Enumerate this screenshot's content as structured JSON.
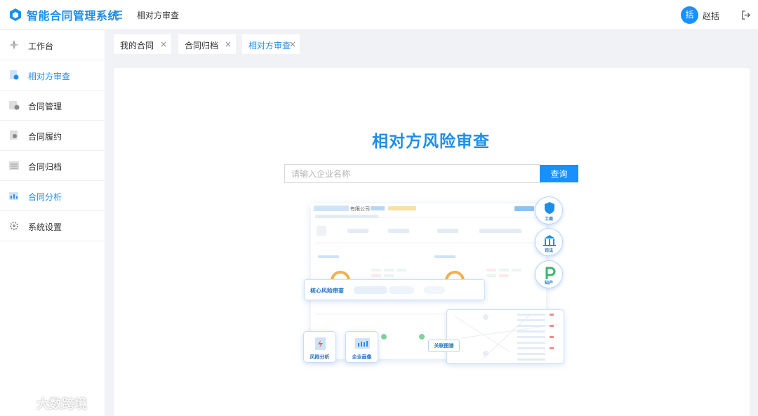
{
  "app": {
    "title": "智能合同管理系统"
  },
  "header": {
    "breadcrumb": "相对方审查",
    "user": {
      "avatar_text": "括",
      "name": "赵括"
    }
  },
  "sidebar": {
    "items": [
      {
        "label": "工作台",
        "icon": "dashboard-icon",
        "active": false
      },
      {
        "label": "相对方审查",
        "icon": "review-icon",
        "active": true
      },
      {
        "label": "合同管理",
        "icon": "contract-manage-icon",
        "active": false
      },
      {
        "label": "合同履约",
        "icon": "fulfillment-icon",
        "active": false
      },
      {
        "label": "合同归档",
        "icon": "archive-icon",
        "active": false
      },
      {
        "label": "合同分析",
        "icon": "analysis-icon",
        "active": true
      },
      {
        "label": "系统设置",
        "icon": "settings-icon",
        "active": false
      }
    ]
  },
  "tabs": [
    {
      "label": "我的合同",
      "close": "×",
      "active": false
    },
    {
      "label": "合同归档",
      "close": "×",
      "active": false
    },
    {
      "label": "相对方审查",
      "close": "×",
      "active": true
    }
  ],
  "main": {
    "title": "相对方风险审查",
    "search": {
      "placeholder": "请输入企业名称",
      "value": "",
      "button": "查询"
    },
    "illustration": {
      "company_suffix": "有限公司",
      "core_bar": "核心风险审查",
      "bubbles": [
        "工商",
        "司法",
        "知产"
      ],
      "tiles": [
        "风险分析",
        "企业画像"
      ],
      "chip": "关联图谱"
    }
  },
  "watermark": {
    "text": "大数跨境"
  },
  "colors": {
    "accent": "#1f8ee8",
    "button": "#1890ff",
    "background": "#f0f2f5"
  }
}
